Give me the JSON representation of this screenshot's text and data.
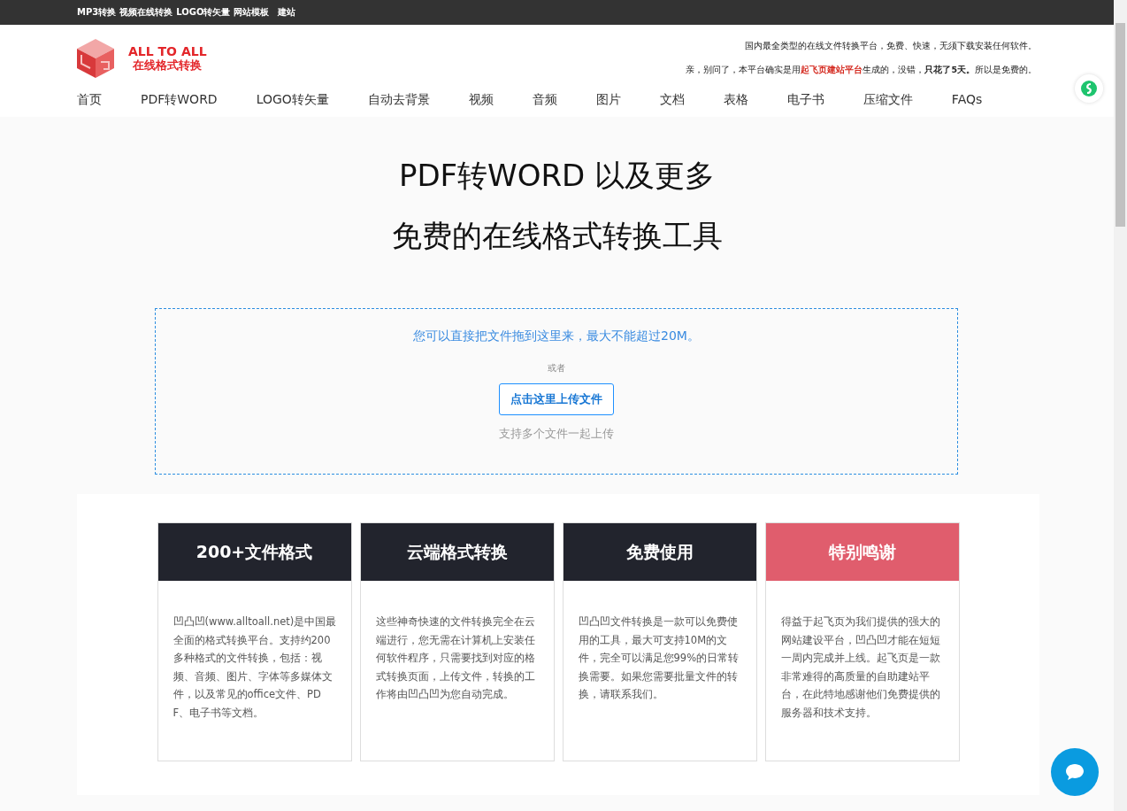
{
  "top_links": [
    "MP3转换",
    "视频在线转换",
    "LOGO转矢量",
    "网站模板",
    "建站"
  ],
  "logo": {
    "title": "ALL TO ALL",
    "subtitle": "在线格式转换"
  },
  "tagline": "国内最全类型的在线文件转换平台，免费、快速，无须下载安装任何软件。",
  "tagline2": {
    "before": "亲，别问了，本平台确实是用",
    "link": "起飞页建站平台",
    "after": "生成的，没错，**只花了5天。**所以是免费的。"
  },
  "nav": [
    "首页",
    "PDF转WORD",
    "LOGO转矢量",
    "自动去背景",
    "视频",
    "音频",
    "图片",
    "文档",
    "表格",
    "电子书",
    "压缩文件",
    "FAQs"
  ],
  "hero": [
    "PDF转WORD 以及更多",
    "免费的在线格式转换工具"
  ],
  "upload": {
    "hint": "您可以直接把文件拖到这里来，最大不能超过20M。",
    "or": "或者",
    "button": "点击这里上传文件",
    "note": "支持多个文件一起上传"
  },
  "cards": [
    {
      "title": "200+文件格式",
      "color": "#22242d",
      "text": "凹凸凹(www.alltoall.net)是中国最全面的格式转换平台。支持约200多种格式的文件转换，包括：视频、音频、图片、字体等多媒体文件，以及常见的office文件、PDF、电子书等文档。"
    },
    {
      "title": "云端格式转换",
      "color": "#22242d",
      "text": "这些神奇快速的文件转换完全在云端进行，您无需在计算机上安装任何软件程序，只需要找到对应的格式转换页面，上传文件，转换的工作将由凹凸凹为您自动完成。"
    },
    {
      "title": "免费使用",
      "color": "#22242d",
      "text": "凹凸凹文件转换是一款可以免费使用的工具，最大可支持10M的文件，完全可以满足您99%的日常转换需要。如果您需要批量文件的转换，请联系我们。"
    },
    {
      "title": "特别鸣谢",
      "color": "#e05d6d",
      "text": "得益于起飞页为我们提供的强大的网站建设平台，凹凸凹才能在短短一周内完成并上线。起飞页是一款非常难得的高质量的自助建站平台，在此特地感谢他们免费提供的服务器和技术支持。"
    }
  ]
}
